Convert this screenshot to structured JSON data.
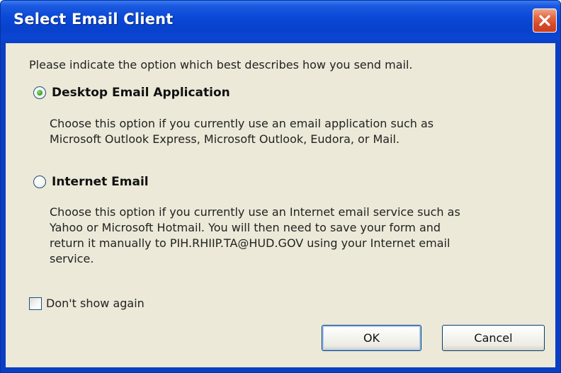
{
  "window": {
    "title": "Select Email Client"
  },
  "dialog": {
    "prompt": "Please indicate the option which best describes how you send mail.",
    "options": [
      {
        "label": "Desktop Email Application",
        "selected": true,
        "description": [
          "Choose this option if you currently use an email application such as",
          "Microsoft Outlook Express, Microsoft Outlook, Eudora, or Mail."
        ]
      },
      {
        "label": "Internet Email",
        "selected": false,
        "description": [
          "Choose this option if you currently use an Internet email service such as",
          "Yahoo or Microsoft Hotmail. You will then need to save your form and",
          "return it manually to  PIH.RHIIP.TA@HUD.GOV using your Internet email",
          "service."
        ]
      }
    ],
    "dont_show_again": {
      "label": "Don't show again",
      "checked": false
    },
    "buttons": {
      "ok": "OK",
      "cancel": "Cancel"
    }
  },
  "colors": {
    "titlebar": "#0a48d6",
    "client": "#ece9d8",
    "close": "#d4482a",
    "radio_selected": "#3fa62c"
  },
  "icons": {
    "close": "close-icon"
  }
}
